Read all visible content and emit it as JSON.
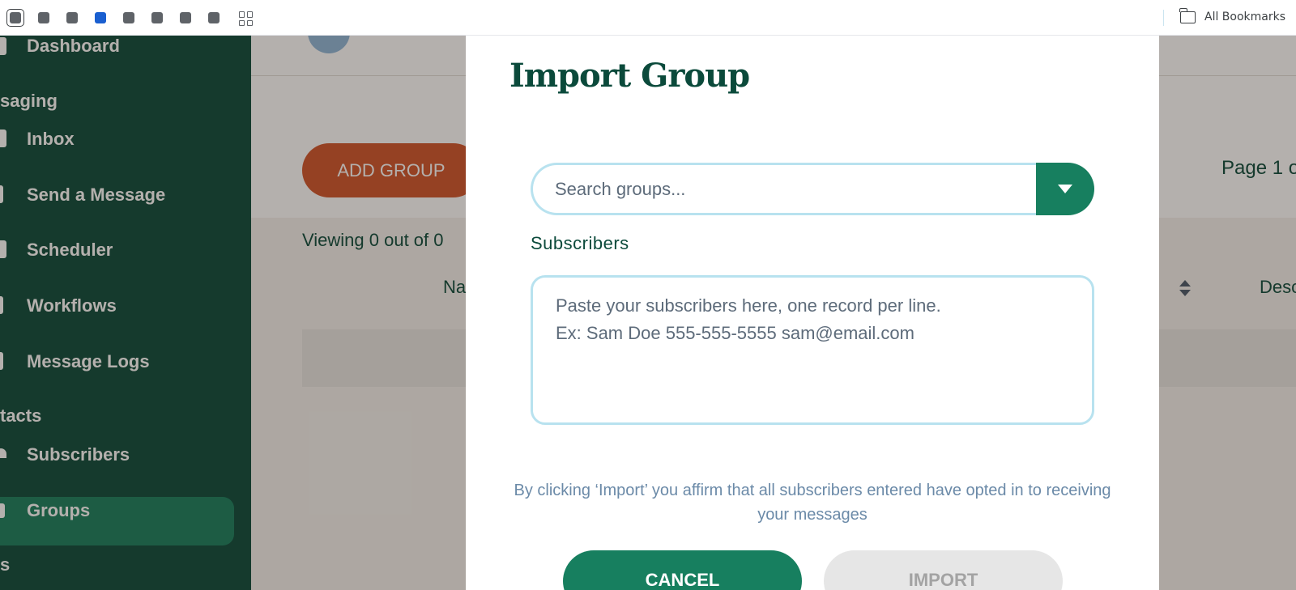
{
  "bookmarks_bar": {
    "all_bookmarks_label": "All Bookmarks",
    "icons": [
      "bookmark-1-icon",
      "bookmark-2-icon",
      "bookmark-3-icon",
      "bookmark-4-icon",
      "bookmark-5-icon",
      "bookmark-6-icon",
      "bookmark-7-icon",
      "bookmark-8-icon",
      "apps-grid-icon",
      "folder-icon"
    ]
  },
  "sidebar": {
    "items": [
      {
        "label": "Dashboard"
      },
      {
        "label": "saging"
      },
      {
        "label": "Inbox"
      },
      {
        "label": "Send a Message"
      },
      {
        "label": "Scheduler"
      },
      {
        "label": "Workflows"
      },
      {
        "label": "Message Logs"
      },
      {
        "label": "tacts"
      },
      {
        "label": "Subscribers"
      },
      {
        "label": "Groups"
      },
      {
        "label": "s"
      }
    ],
    "active_item": "Groups"
  },
  "main": {
    "add_group_label": "ADD GROUP",
    "page_indicator": "Page 1 o",
    "viewing_text": "Viewing 0 out of 0",
    "col_name": "Na",
    "col_desc": "Desc"
  },
  "modal": {
    "title": "Import Group",
    "search_placeholder": "Search groups...",
    "subscribers_label": "Subscribers",
    "subscribers_placeholder": "Paste your subscribers here, one record per line.\nEx: Sam Doe 555-555-5555 sam@email.com",
    "disclaimer": "By clicking ‘Import’ you affirm that all subscribers entered have opted in to receiving your messages",
    "cancel_label": "CANCEL",
    "import_label": "IMPORT"
  },
  "colors": {
    "sidebar_bg": "#0b4a3b",
    "accent_green": "#177f5f",
    "add_group_orange": "#d0552b",
    "input_border": "#b8e2ef"
  }
}
